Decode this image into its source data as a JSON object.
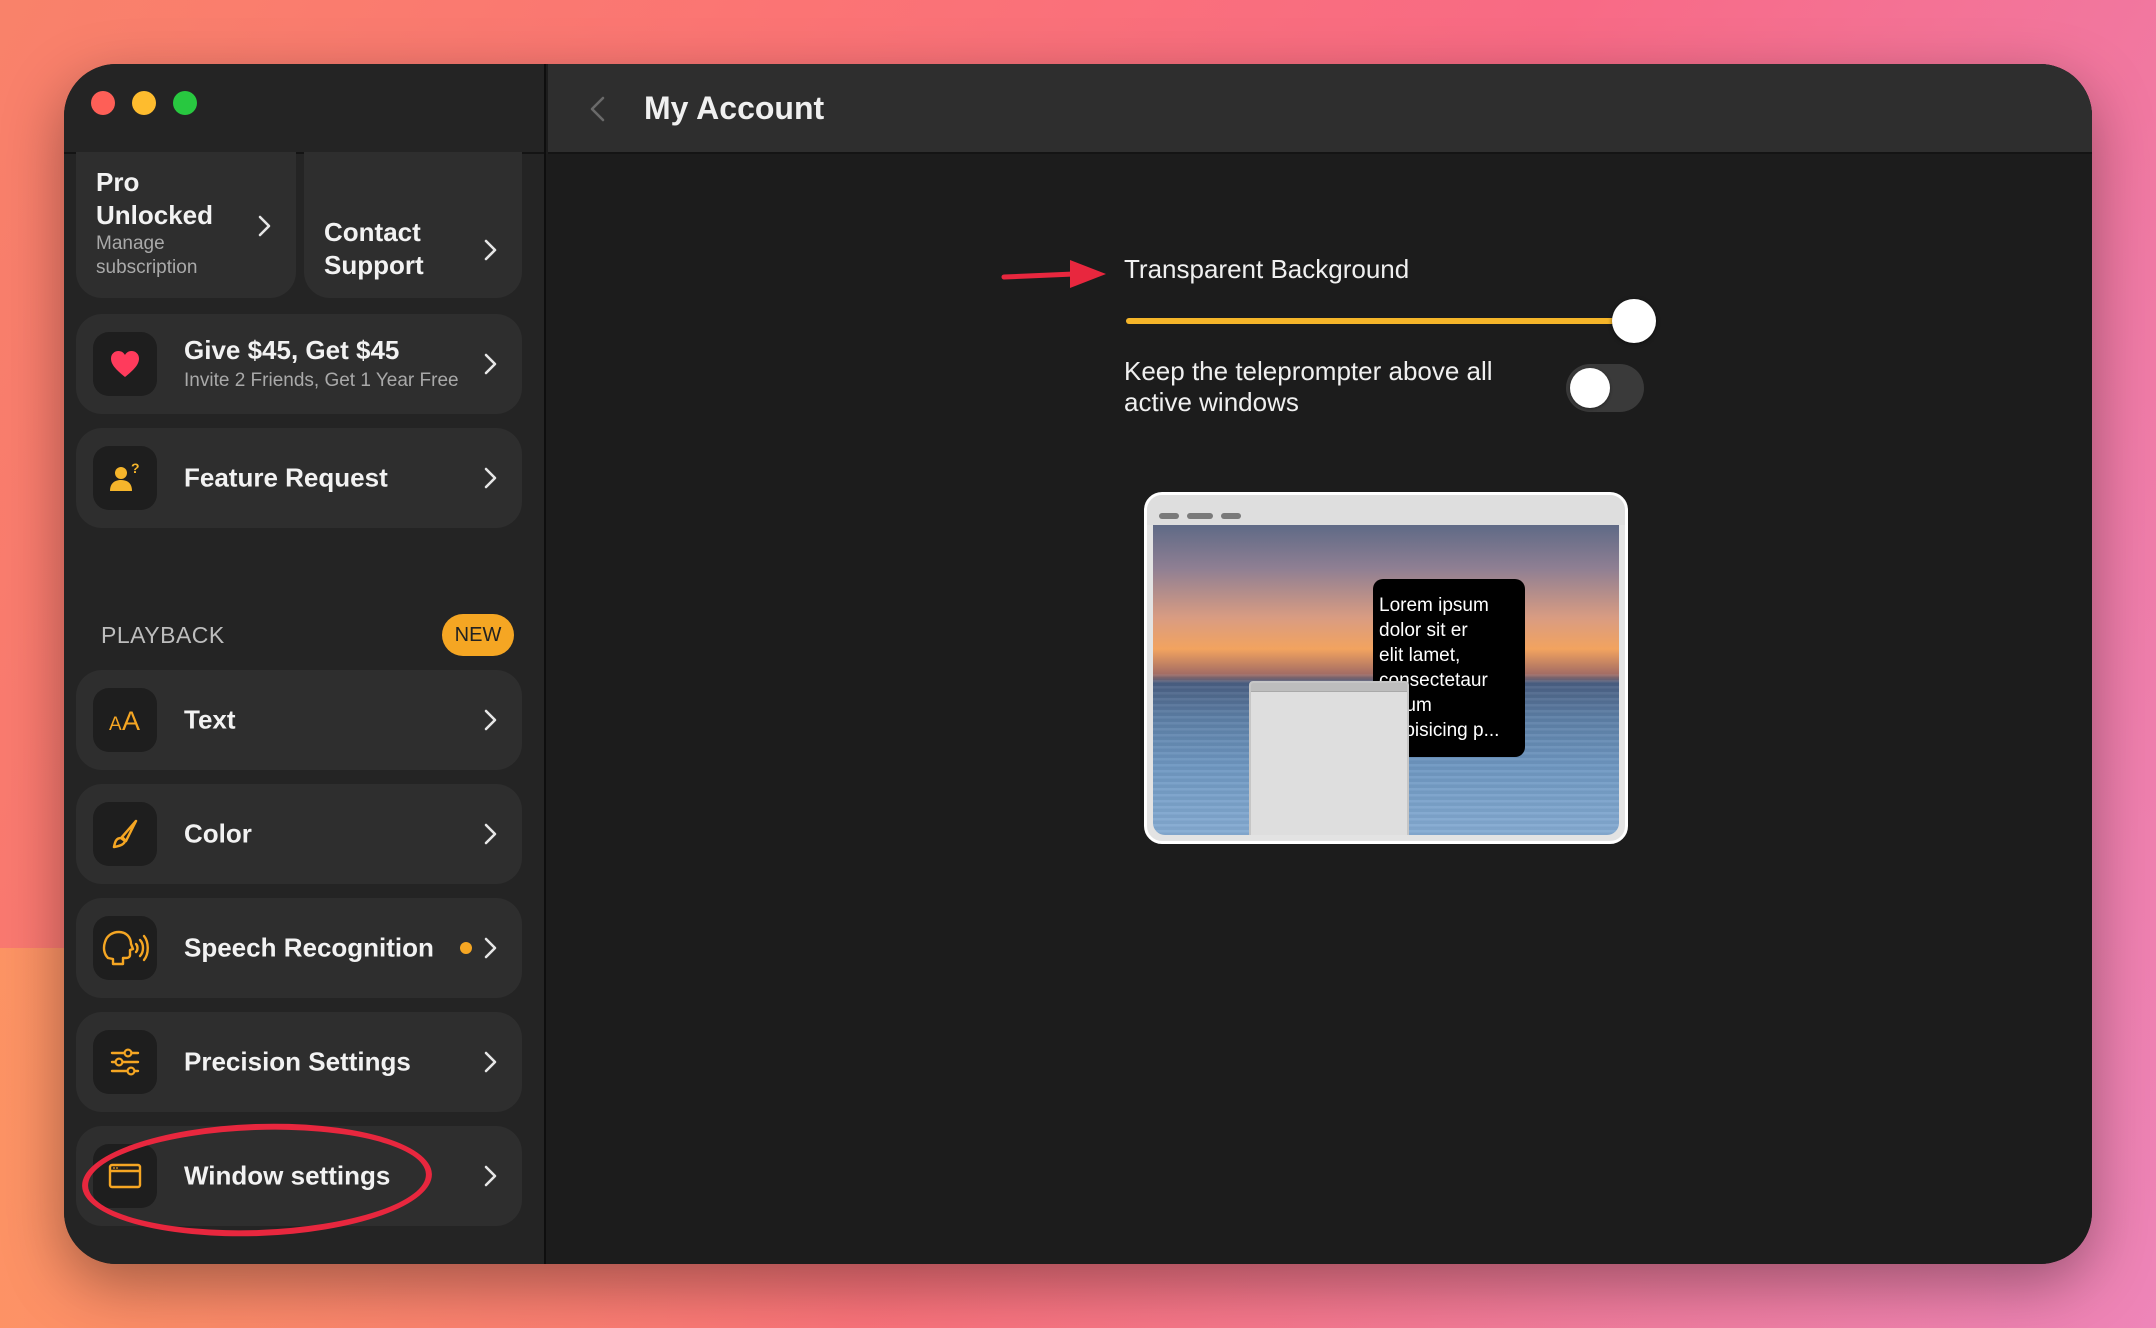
{
  "window": {
    "traffic_lights": {
      "close": "#fe5f57",
      "minimize": "#febc2e",
      "zoom": "#28c840"
    }
  },
  "sidebar": {
    "pro_card": {
      "title_line1": "Pro",
      "title_line2": "Unlocked",
      "subtitle_line1": "Manage",
      "subtitle_line2": "subscription"
    },
    "support_card": {
      "title_line1": "Contact",
      "title_line2": "Support"
    },
    "referral": {
      "title": "Give $45, Get $45",
      "subtitle": "Invite 2 Friends, Get 1 Year Free",
      "icon": "heart-icon"
    },
    "feature_request": {
      "label": "Feature Request",
      "icon": "person-question-icon"
    },
    "section": {
      "label": "PLAYBACK",
      "badge": "NEW"
    },
    "items": [
      {
        "label": "Text",
        "icon": "text-size-icon",
        "indicator": false
      },
      {
        "label": "Color",
        "icon": "brush-icon",
        "indicator": false
      },
      {
        "label": "Speech Recognition",
        "icon": "speaking-head-icon",
        "indicator": true
      },
      {
        "label": "Precision Settings",
        "icon": "sliders-icon",
        "indicator": false
      },
      {
        "label": "Window settings",
        "icon": "window-icon",
        "indicator": false
      }
    ]
  },
  "header": {
    "title": "My Account"
  },
  "settings": {
    "transparent_background": {
      "label": "Transparent Background",
      "value": 1.0
    },
    "keep_above": {
      "label_line1": "Keep the teleprompter above all",
      "label_line2": "active windows",
      "enabled": false
    }
  },
  "preview": {
    "lorem_lines": [
      "Lorem ipsum",
      "dolor sit er",
      "elit lamet,",
      "consectetaur",
      "cillium",
      "adipisicing p..."
    ]
  },
  "colors": {
    "accent": "#f5a623",
    "annotation": "#e8273e",
    "heart": "#ff3b5c"
  }
}
